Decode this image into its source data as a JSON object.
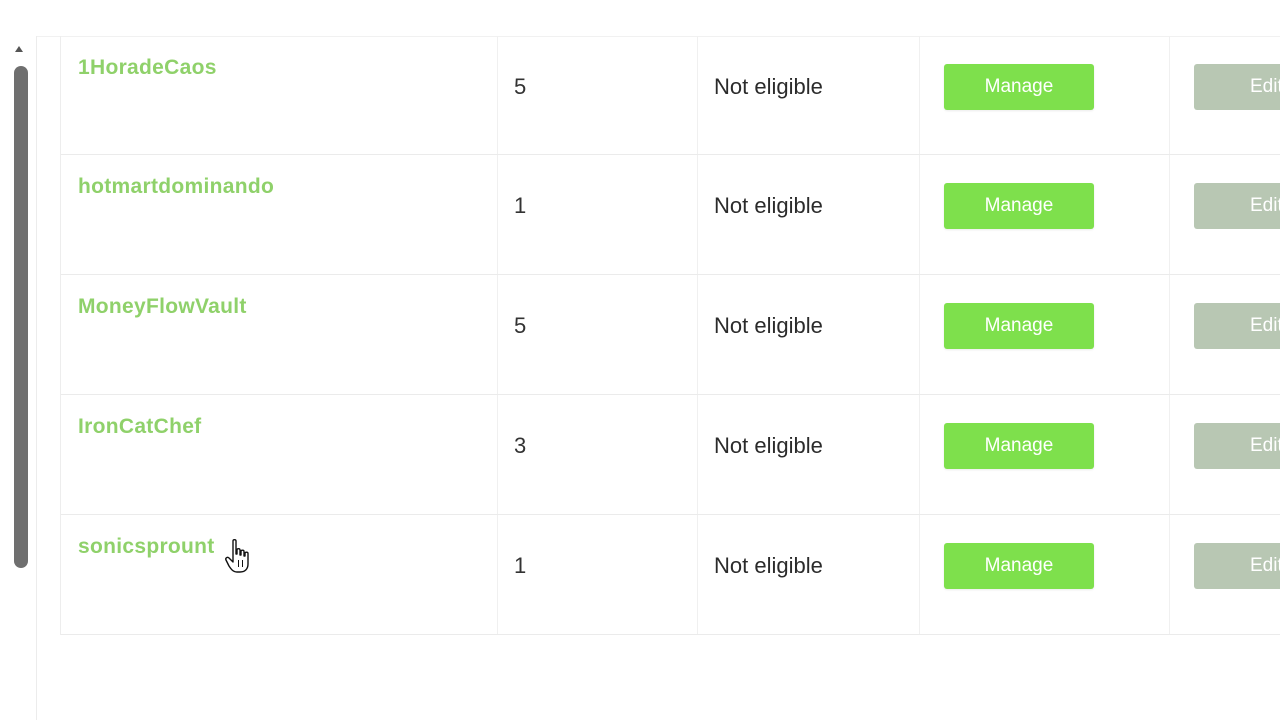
{
  "rows": [
    {
      "name": "1HoradeCaos",
      "count": "5",
      "status": "Not eligible",
      "manage_label": "Manage",
      "edit_label": "Edit"
    },
    {
      "name": "hotmartdominando",
      "count": "1",
      "status": "Not eligible",
      "manage_label": "Manage",
      "edit_label": "Edit"
    },
    {
      "name": "MoneyFlowVault",
      "count": "5",
      "status": "Not eligible",
      "manage_label": "Manage",
      "edit_label": "Edit"
    },
    {
      "name": "IronCatChef",
      "count": "3",
      "status": "Not eligible",
      "manage_label": "Manage",
      "edit_label": "Edit"
    },
    {
      "name": "sonicsprount",
      "count": "1",
      "status": "Not eligible",
      "manage_label": "Manage",
      "edit_label": "Edit"
    }
  ],
  "colors": {
    "name_link": "#8fd16a",
    "manage_button": "#7ee04c",
    "edit_button": "#b8c7b3",
    "scrollbar": "#6f6f6f"
  },
  "icons": {
    "cursor": "hand-pointer-icon",
    "scroll_up": "scroll-up-arrow-icon"
  }
}
